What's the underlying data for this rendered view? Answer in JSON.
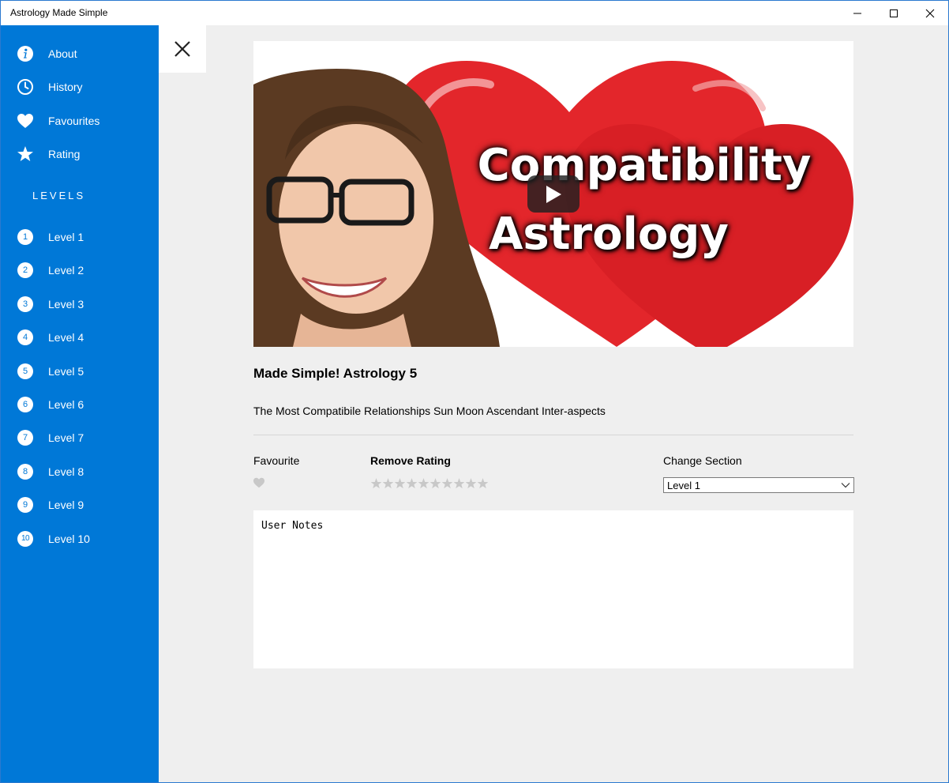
{
  "window": {
    "title": "Astrology Made Simple"
  },
  "sidebar": {
    "items": [
      {
        "label": "About",
        "icon": "info-icon"
      },
      {
        "label": "History",
        "icon": "clock-icon"
      },
      {
        "label": "Favourites",
        "icon": "heart-icon"
      },
      {
        "label": "Rating",
        "icon": "star-icon"
      }
    ],
    "levels_heading": "LEVELS",
    "levels": [
      {
        "num": "1",
        "label": "Level 1"
      },
      {
        "num": "2",
        "label": "Level 2"
      },
      {
        "num": "3",
        "label": "Level 3"
      },
      {
        "num": "4",
        "label": "Level 4"
      },
      {
        "num": "5",
        "label": "Level 5"
      },
      {
        "num": "6",
        "label": "Level 6"
      },
      {
        "num": "7",
        "label": "Level 7"
      },
      {
        "num": "8",
        "label": "Level 8"
      },
      {
        "num": "9",
        "label": "Level 9"
      },
      {
        "num": "10",
        "label": "Level 10"
      }
    ]
  },
  "video": {
    "thumbnail_text_line1": "Compatibility",
    "thumbnail_text_line2": "Astrology",
    "title": "Made Simple! Astrology 5",
    "description": "The Most Compatibile Relationships Sun Moon Ascendant Inter-aspects"
  },
  "controls": {
    "favourite_label": "Favourite",
    "rating_label": "Remove Rating",
    "rating_max": 10,
    "rating_value": 0,
    "section_label": "Change Section",
    "section_selected": "Level 1"
  },
  "notes": {
    "placeholder": "User Notes"
  },
  "colors": {
    "accent": "#0078d7",
    "background": "#efefef",
    "inactive_icon": "#c8c8c8"
  }
}
